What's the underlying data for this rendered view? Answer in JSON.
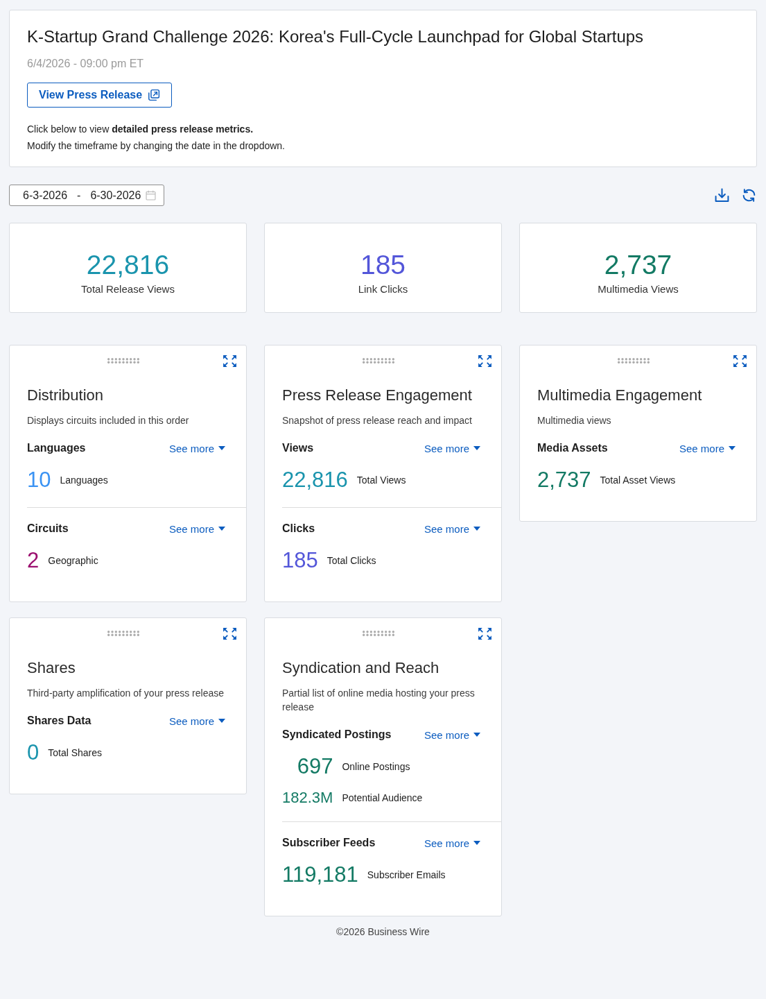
{
  "header": {
    "title": "K-Startup Grand Challenge 2026: Korea's Full-Cycle Launchpad for Global Startups",
    "date": "6/4/2026 - 09:00 pm ET",
    "button": "View Press Release",
    "notes": [
      "Click below to view **detailed press release metrics.**",
      "Modify the timeframe by changing the date in the dropdown."
    ]
  },
  "date_range": {
    "start": "6-3-2026",
    "separator": "-",
    "end": "6-30-2026"
  },
  "stats": [
    {
      "value": "22,816",
      "label": "Total Release Views",
      "color": "#1a94ad"
    },
    {
      "value": "185",
      "label": "Link Clicks",
      "color": "#5356d9"
    },
    {
      "value": "2,737",
      "label": "Multimedia Views",
      "color": "#137a64"
    }
  ],
  "widget_columns": [
    [
      {
        "title": "Distribution",
        "description": "Displays circuits included in this order",
        "sections": [
          {
            "heading": "Languages",
            "link": "See more",
            "metrics": [
              {
                "value": "10",
                "label": "Languages",
                "color": "#3b93f3",
                "kind": "major"
              }
            ]
          },
          {
            "heading": "Circuits",
            "link": "See more",
            "metrics": [
              {
                "value": "2",
                "label": "Geographic",
                "color": "#9b0f6f",
                "kind": "major"
              }
            ]
          }
        ]
      },
      {
        "title": "Shares",
        "description": "Third-party amplification of your press release",
        "sections": [
          {
            "heading": "Shares Data",
            "link": "See more",
            "metrics": [
              {
                "value": "0",
                "label": "Total Shares",
                "color": "#1a94ad",
                "kind": "major"
              }
            ]
          }
        ]
      }
    ],
    [
      {
        "title": "Press Release Engagement",
        "description": "Snapshot of press release reach and impact",
        "sections": [
          {
            "heading": "Views",
            "link": "See more",
            "metrics": [
              {
                "value": "22,816",
                "label": "Total Views",
                "color": "#1a94ad",
                "kind": "major"
              }
            ]
          },
          {
            "heading": "Clicks",
            "link": "See more",
            "metrics": [
              {
                "value": "185",
                "label": "Total Clicks",
                "color": "#5356d9",
                "kind": "major"
              }
            ]
          }
        ]
      },
      {
        "title": "Syndication and Reach",
        "description": "Partial list of online media hosting your press release",
        "sections": [
          {
            "heading": "Syndicated Postings",
            "link": "See more",
            "metrics": [
              {
                "value": "697",
                "label": "Online Postings",
                "color": "#137a64",
                "kind": "major"
              },
              {
                "value": "182.3M",
                "label": "Potential Audience",
                "color": "#137a64",
                "kind": "minor"
              }
            ]
          },
          {
            "heading": "Subscriber Feeds",
            "link": "See more",
            "metrics": [
              {
                "value": "119,181",
                "label": "Subscriber Emails",
                "color": "#137a64",
                "kind": "major"
              }
            ]
          }
        ]
      }
    ],
    [
      {
        "title": "Multimedia Engagement",
        "description": "Multimedia views",
        "sections": [
          {
            "heading": "Media Assets",
            "link": "See more",
            "metrics": [
              {
                "value": "2,737",
                "label": "Total Asset Views",
                "color": "#137a64",
                "kind": "major"
              }
            ]
          }
        ]
      }
    ]
  ],
  "footer": "©2026 Business Wire"
}
